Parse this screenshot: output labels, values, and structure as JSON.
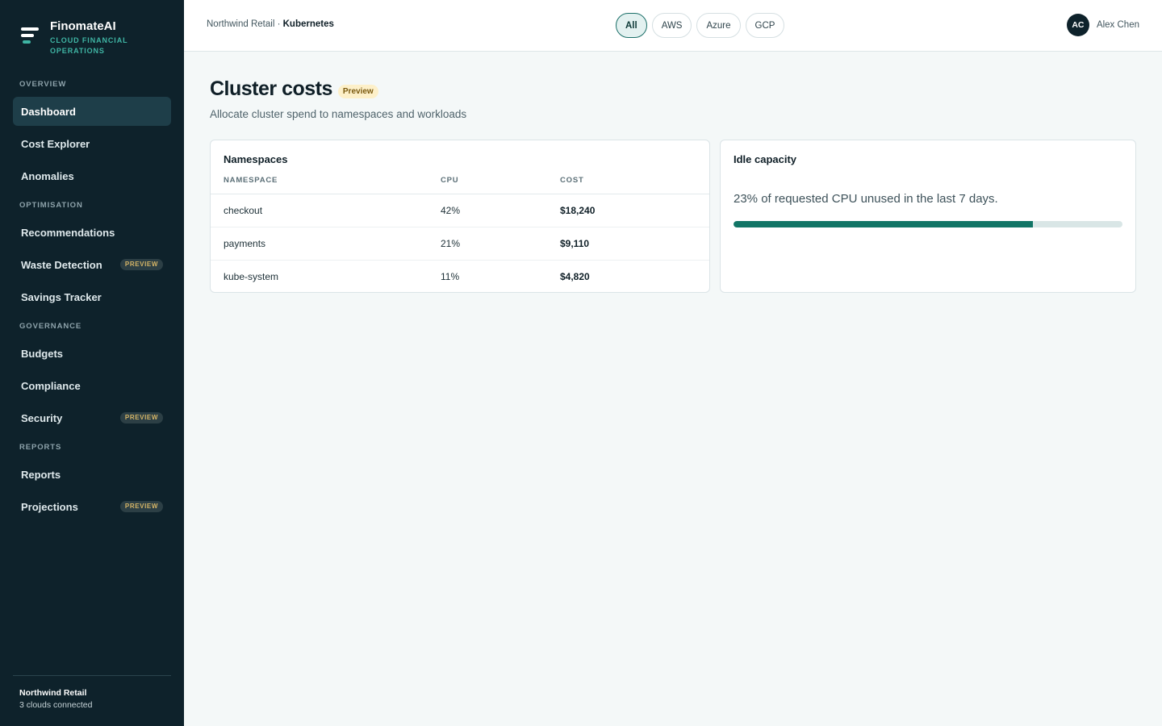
{
  "brand": {
    "name": "FinomateAI",
    "tagline": "CLOUD FINANCIAL OPERATIONS"
  },
  "sidebar": {
    "sections": [
      {
        "title": "OVERVIEW",
        "items": [
          {
            "label": "Dashboard",
            "active": true,
            "badge": ""
          },
          {
            "label": "Cost Explorer",
            "badge": ""
          },
          {
            "label": "Anomalies",
            "badge": ""
          }
        ]
      },
      {
        "title": "OPTIMISATION",
        "items": [
          {
            "label": "Recommendations",
            "badge": ""
          },
          {
            "label": "Waste Detection",
            "badge": "PREVIEW"
          },
          {
            "label": "Savings Tracker",
            "badge": ""
          }
        ]
      },
      {
        "title": "GOVERNANCE",
        "items": [
          {
            "label": "Budgets",
            "badge": ""
          },
          {
            "label": "Compliance",
            "badge": ""
          },
          {
            "label": "Security",
            "badge": "PREVIEW"
          }
        ]
      },
      {
        "title": "REPORTS",
        "items": [
          {
            "label": "Reports",
            "badge": ""
          },
          {
            "label": "Projections",
            "badge": "PREVIEW"
          }
        ]
      }
    ],
    "footer": {
      "org": "Northwind Retail",
      "status": "3 clouds connected"
    }
  },
  "header": {
    "breadcrumb": {
      "org": "Northwind Retail",
      "separator": " · ",
      "current": "Kubernetes"
    },
    "cloud_filters": [
      {
        "label": "All",
        "active": true
      },
      {
        "label": "AWS"
      },
      {
        "label": "Azure"
      },
      {
        "label": "GCP"
      }
    ],
    "user": {
      "initials": "AC",
      "name": "Alex Chen"
    }
  },
  "page": {
    "title": "Cluster costs",
    "badge": "Preview",
    "subtitle": "Allocate cluster spend to namespaces and workloads"
  },
  "namespaces": {
    "title": "Namespaces",
    "columns": [
      "NAMESPACE",
      "CPU",
      "COST"
    ],
    "rows": [
      {
        "namespace": "checkout",
        "cpu": "42%",
        "cost": "$18,240"
      },
      {
        "namespace": "payments",
        "cpu": "21%",
        "cost": "$9,110"
      },
      {
        "namespace": "kube-system",
        "cpu": "11%",
        "cost": "$4,820"
      }
    ]
  },
  "idle_capacity": {
    "title": "Idle capacity",
    "text": "23% of requested CPU unused in the last 7 days.",
    "progress_percent": 77
  },
  "colors": {
    "sidebar_bg": "#0e222b",
    "accent": "#127566",
    "badge_text": "#d4b466"
  },
  "icons": {
    "brand": "finomate-logo-icon"
  }
}
